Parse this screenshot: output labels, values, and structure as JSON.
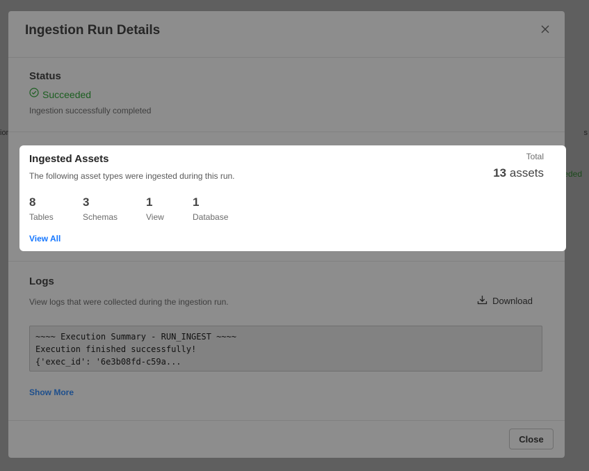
{
  "background": {
    "edge_left_text": "ion",
    "edge_right_text": "s",
    "edge_right_status": "eded"
  },
  "modal": {
    "title": "Ingestion Run Details",
    "close_icon": "close-icon"
  },
  "status": {
    "title": "Status",
    "value": "Succeeded",
    "description": "Ingestion successfully completed",
    "icon": "check-circle-icon",
    "color": "#1b5e20"
  },
  "assets": {
    "title": "Ingested Assets",
    "description": "The following asset types were ingested during this run.",
    "total_label": "Total",
    "total_count": "13",
    "total_unit": "assets",
    "stats": [
      {
        "count": "8",
        "label": "Tables"
      },
      {
        "count": "3",
        "label": "Schemas"
      },
      {
        "count": "1",
        "label": "View"
      },
      {
        "count": "1",
        "label": "Database"
      }
    ],
    "view_all": "View All",
    "link_color": "#1677ff"
  },
  "logs": {
    "title": "Logs",
    "description": "View logs that were collected during the ingestion run.",
    "download_label": "Download",
    "download_icon": "download-icon",
    "lines": [
      "~~~~ Execution Summary - RUN_INGEST ~~~~",
      "Execution finished successfully!",
      "{'exec_id': '6e3b08fd-c59a..."
    ],
    "show_more": "Show More"
  },
  "footer": {
    "close_label": "Close"
  }
}
